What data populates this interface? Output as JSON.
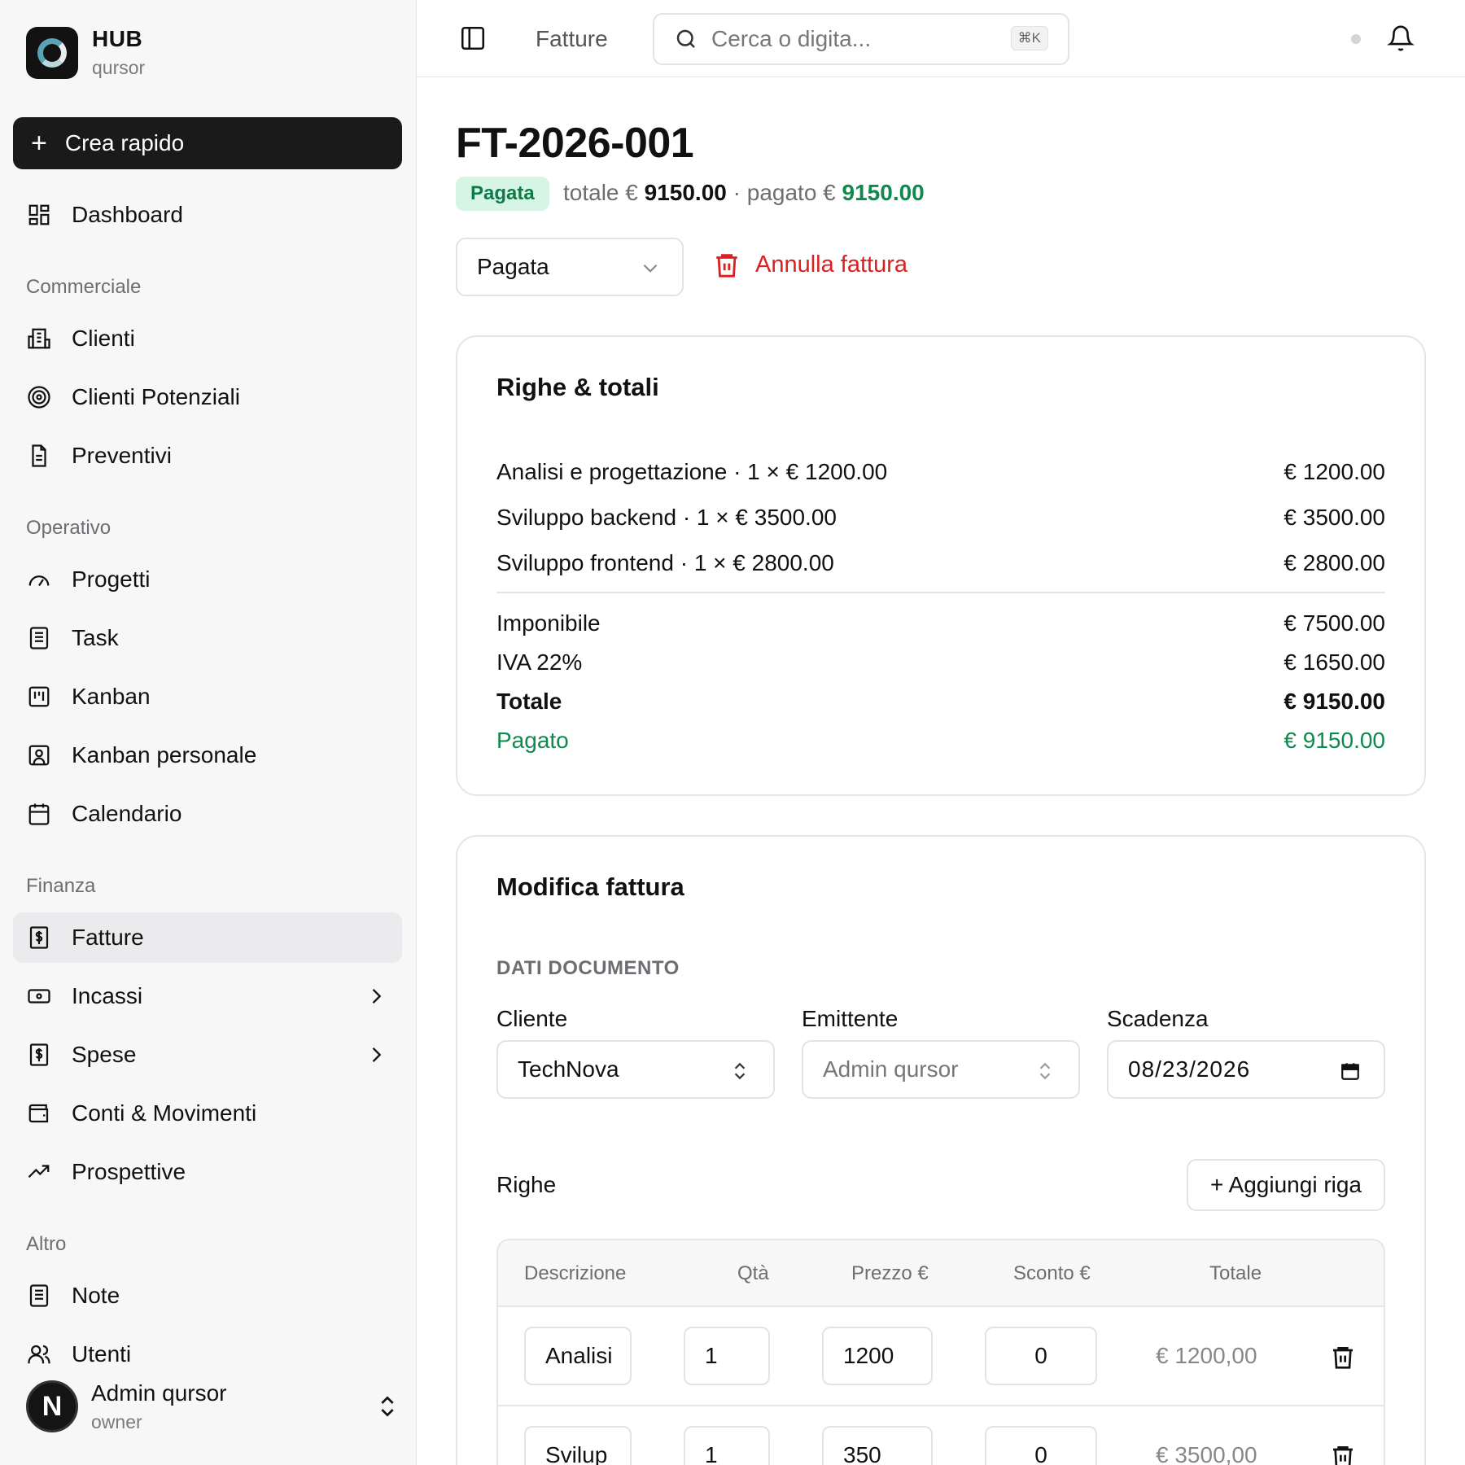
{
  "brand": {
    "name": "HUB",
    "sub": "qursor"
  },
  "quick_create": "Crea rapido",
  "nav": {
    "dashboard": "Dashboard",
    "sections": {
      "commerciale": "Commerciale",
      "operativo": "Operativo",
      "finanza": "Finanza",
      "altro": "Altro"
    },
    "items": {
      "clienti": "Clienti",
      "clienti_potenziali": "Clienti Potenziali",
      "preventivi": "Preventivi",
      "progetti": "Progetti",
      "task": "Task",
      "kanban": "Kanban",
      "kanban_personale": "Kanban personale",
      "calendario": "Calendario",
      "fatture": "Fatture",
      "incassi": "Incassi",
      "spese": "Spese",
      "conti": "Conti & Movimenti",
      "prospettive": "Prospettive",
      "note": "Note",
      "utenti": "Utenti"
    }
  },
  "user": {
    "initial": "N",
    "name": "Admin qursor",
    "role": "owner"
  },
  "header": {
    "breadcrumb": "Fatture",
    "search_placeholder": "Cerca o digita...",
    "shortcut": "⌘K"
  },
  "invoice": {
    "number": "FT-2026-001",
    "status_badge": "Pagata",
    "summary": {
      "total_label": "totale €",
      "total": "9150.00",
      "sep": "·",
      "paid_label": "pagato €",
      "paid": "9150.00"
    },
    "status_select": "Pagata",
    "cancel_label": "Annulla fattura"
  },
  "totals_card": {
    "title": "Righe & totali",
    "lines": [
      {
        "desc": "Analisi e progettazione · 1 × € 1200.00",
        "amount": "€ 1200.00"
      },
      {
        "desc": "Sviluppo backend · 1 × € 3500.00",
        "amount": "€ 3500.00"
      },
      {
        "desc": "Sviluppo frontend · 1 × € 2800.00",
        "amount": "€ 2800.00"
      }
    ],
    "imponibile_label": "Imponibile",
    "imponibile": "€ 7500.00",
    "iva_label": "IVA 22%",
    "iva": "€ 1650.00",
    "totale_label": "Totale",
    "totale": "€ 9150.00",
    "pagato_label": "Pagato",
    "pagato": "€ 9150.00",
    "colors": {
      "paid_green": "#0f8a4f",
      "danger_red": "#dc1f1f"
    }
  },
  "edit_card": {
    "title": "Modifica fattura",
    "section": "DATI DOCUMENTO",
    "cliente_label": "Cliente",
    "cliente_value": "TechNova",
    "emittente_label": "Emittente",
    "emittente_value": "Admin qursor",
    "scadenza_label": "Scadenza",
    "scadenza_value": "08/23/2026",
    "righe_label": "Righe",
    "add_row": "+ Aggiungi riga",
    "columns": [
      "Descrizione",
      "Qtà",
      "Prezzo €",
      "Sconto €",
      "Totale"
    ],
    "rows": [
      {
        "desc": "Analisi",
        "qty": "1",
        "price": "1200",
        "discount": "0",
        "total": "€ 1200,00"
      },
      {
        "desc": "Svilup",
        "qty": "1",
        "price": "350",
        "discount": "0",
        "total": "€ 3500,00"
      }
    ]
  }
}
